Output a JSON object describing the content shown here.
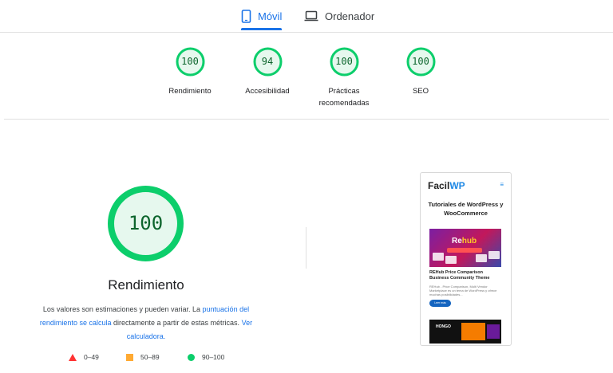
{
  "tabs": {
    "mobile": "Móvil",
    "desktop": "Ordenador",
    "active": "mobile"
  },
  "categories": [
    {
      "score": "100",
      "label": "Rendimiento"
    },
    {
      "score": "94",
      "label": "Accesibilidad"
    },
    {
      "score": "100",
      "label": "Prácticas recomendadas"
    },
    {
      "score": "100",
      "label": "SEO"
    }
  ],
  "performance": {
    "score": "100",
    "score_fraction": 1.0,
    "title": "Rendimiento",
    "desc_part1": "Los valores son estimaciones y pueden variar. La ",
    "desc_link1": "puntuación del rendimiento se calcula",
    "desc_part2": " directamente a partir de estas métricas. ",
    "desc_link2": "Ver calculadora."
  },
  "legend": {
    "fail": "0–49",
    "average": "50–89",
    "pass": "90–100"
  },
  "preview": {
    "brand_main": "Facil",
    "brand_accent": "WP",
    "menu_icon": "≡",
    "tagline": "Tutoriales de WordPress y WooCommerce",
    "hero_logo_a": "Re",
    "hero_logo_b": "hub",
    "post_title": "REHub Price Comparison Business Community Theme",
    "post_text": "REHub - Price Comparison, Multi Vendor Marketplace es un tema de WordPress y ofrece muchas posibilidades...",
    "button": "Leer más",
    "hero2_logo": "HONGO"
  },
  "colors": {
    "pass": "#0cce6b",
    "pass_fill": "#e6f8ee",
    "pass_text": "#0d652d",
    "average": "#ffaa33",
    "fail": "#ff3333",
    "link": "#1a73e8"
  }
}
